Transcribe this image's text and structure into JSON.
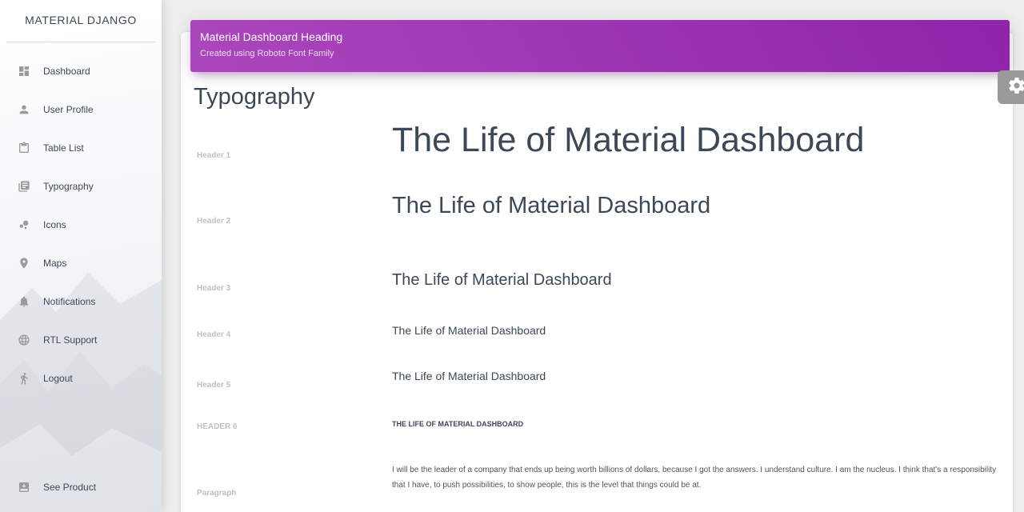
{
  "brand": "MATERIAL DJANGO",
  "sidebar": {
    "items": [
      {
        "label": "Dashboard",
        "icon": "dashboard-icon"
      },
      {
        "label": "User Profile",
        "icon": "person-icon"
      },
      {
        "label": "Table List",
        "icon": "clipboard-icon"
      },
      {
        "label": "Typography",
        "icon": "library-books-icon"
      },
      {
        "label": "Icons",
        "icon": "bubble-chart-icon"
      },
      {
        "label": "Maps",
        "icon": "location-pin-icon"
      },
      {
        "label": "Notifications",
        "icon": "bell-icon"
      },
      {
        "label": "RTL Support",
        "icon": "globe-icon"
      },
      {
        "label": "Logout",
        "icon": "running-icon"
      }
    ],
    "bottom": {
      "label": "See Product",
      "icon": "product-icon"
    }
  },
  "header": {
    "title": "Material Dashboard Heading",
    "subtitle": "Created using Roboto Font Family"
  },
  "main": {
    "section_title": "Typography",
    "rows": [
      {
        "label": "Header 1",
        "sample": "The Life of Material Dashboard"
      },
      {
        "label": "Header 2",
        "sample": "The Life of Material Dashboard"
      },
      {
        "label": "Header 3",
        "sample": "The Life of Material Dashboard"
      },
      {
        "label": "Header 4",
        "sample": "The Life of Material Dashboard"
      },
      {
        "label": "Header 5",
        "sample": "The Life of Material Dashboard"
      },
      {
        "label": "HEADER 6",
        "sample": "THE LIFE OF MATERIAL DASHBOARD"
      },
      {
        "label": "Paragraph",
        "sample": "I will be the leader of a company that ends up being worth billions of dollars, because I got the answers. I understand culture. I am the nucleus. I think that's a responsibility that I have, to push possibilities, to show people, this is the level that things could be at."
      }
    ]
  },
  "colors": {
    "header_gradient_start": "#ab47bc",
    "header_gradient_end": "#8e24aa",
    "text": "#3c4858",
    "label": "#c0c0c0"
  },
  "fixed_plugin": {
    "icon": "gear-icon"
  }
}
